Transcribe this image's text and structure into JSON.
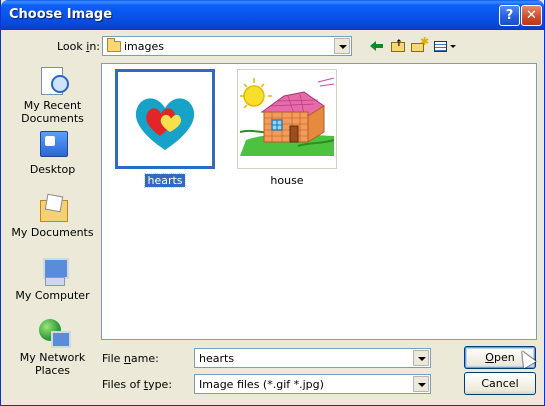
{
  "window": {
    "title": "Choose Image",
    "help_label": "?",
    "close_label": "✕"
  },
  "look_in": {
    "label_pre": "Look ",
    "label_u": "i",
    "label_post": "n:",
    "value": "images"
  },
  "toolbar": {
    "icons": [
      "back-arrow-icon",
      "up-one-level-icon",
      "create-new-folder-icon",
      "view-menu-icon"
    ]
  },
  "places": [
    {
      "id": "recent",
      "label_lines": [
        "My Recent",
        "Documents"
      ],
      "icon": "recent-documents-icon"
    },
    {
      "id": "desktop",
      "label_lines": [
        "Desktop"
      ],
      "icon": "desktop-icon"
    },
    {
      "id": "documents",
      "label_lines": [
        "My Documents"
      ],
      "icon": "my-documents-icon"
    },
    {
      "id": "computer",
      "label_lines": [
        "My Computer"
      ],
      "icon": "my-computer-icon"
    },
    {
      "id": "network",
      "label_lines": [
        "My Network",
        "Places"
      ],
      "icon": "my-network-places-icon"
    }
  ],
  "files": [
    {
      "name": "hearts",
      "selected": true
    },
    {
      "name": "house",
      "selected": false
    }
  ],
  "file_name": {
    "label_pre": "File ",
    "label_u": "n",
    "label_post": "ame:",
    "value": "hearts"
  },
  "file_type": {
    "label_pre": "Files of ",
    "label_u": "t",
    "label_post": "ype:",
    "value": "Image files (*.gif *.jpg)"
  },
  "buttons": {
    "open_u": "O",
    "open_rest": "pen",
    "cancel": "Cancel"
  },
  "colors": {
    "title_bar": "#0a5bf5",
    "selection": "#316ac5",
    "dialog_bg": "#ece9d8"
  }
}
